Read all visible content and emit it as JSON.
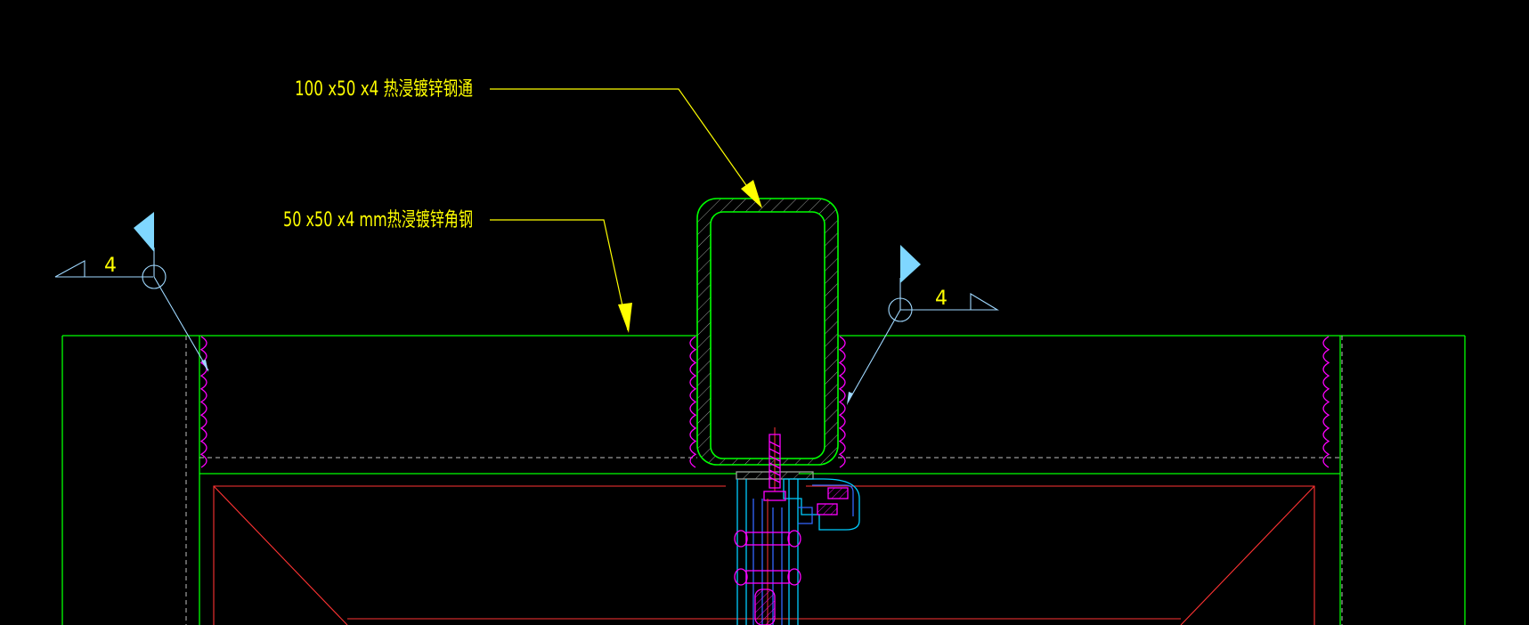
{
  "labels": {
    "steel_tube": "100 x50 x4 热浸镀锌钢通",
    "angle_steel": "50 x50 x4 mm热浸镀锌角钢"
  },
  "weld_symbols": {
    "left_size": "4",
    "right_size": "4"
  },
  "colors": {
    "background": "#000000",
    "annotation_yellow": "#ffff00",
    "outline_green": "#00ff00",
    "weld_magenta": "#ff00ff",
    "flag_cyan": "#7fd7ff",
    "leader_cyan": "#9fd8ff",
    "panel_red": "#ff3333",
    "bracket_cyan": "#00ccff",
    "bracket_blue": "#3366ff",
    "hidden_grey": "#bfbfbf",
    "hatch_grey": "#9aa09a"
  }
}
